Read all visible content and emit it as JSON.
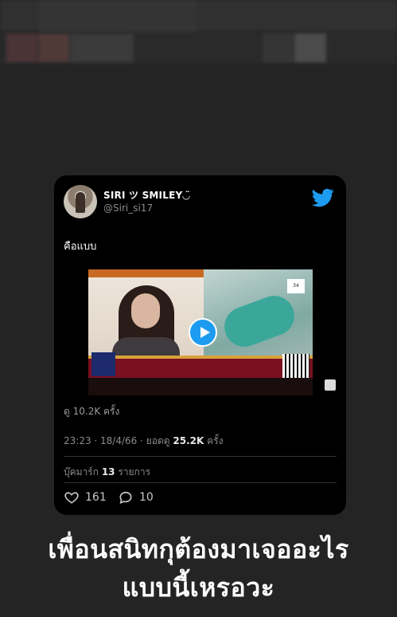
{
  "tweet": {
    "display_name": "SIRI ツ SMILEY◡̈",
    "handle": "@Siri_si17",
    "text": "คือแบบ",
    "views_label": "ดู 10.2K ครั้ง",
    "time_date": "23:23 · 18/4/66 · ยอดดู ",
    "view_count": "25.2K",
    "view_unit": " ครั้ง",
    "bookmarks_prefix": "บุ๊คมาร์ก ",
    "bookmarks_count": "13",
    "bookmarks_suffix": " รายการ",
    "likes": "161",
    "replies": "10"
  },
  "media": {
    "badge": "34"
  },
  "caption": {
    "line1": "เพื่อนสนิทกุต้องมาเจออะไร",
    "line2": "แบบนี้เหรอวะ"
  },
  "colors": {
    "accent": "#1d9bf0",
    "card_bg": "#000000",
    "page_bg": "#242424"
  },
  "icons": [
    "twitter-bird-icon",
    "play-icon",
    "heart-icon",
    "reply-icon"
  ]
}
